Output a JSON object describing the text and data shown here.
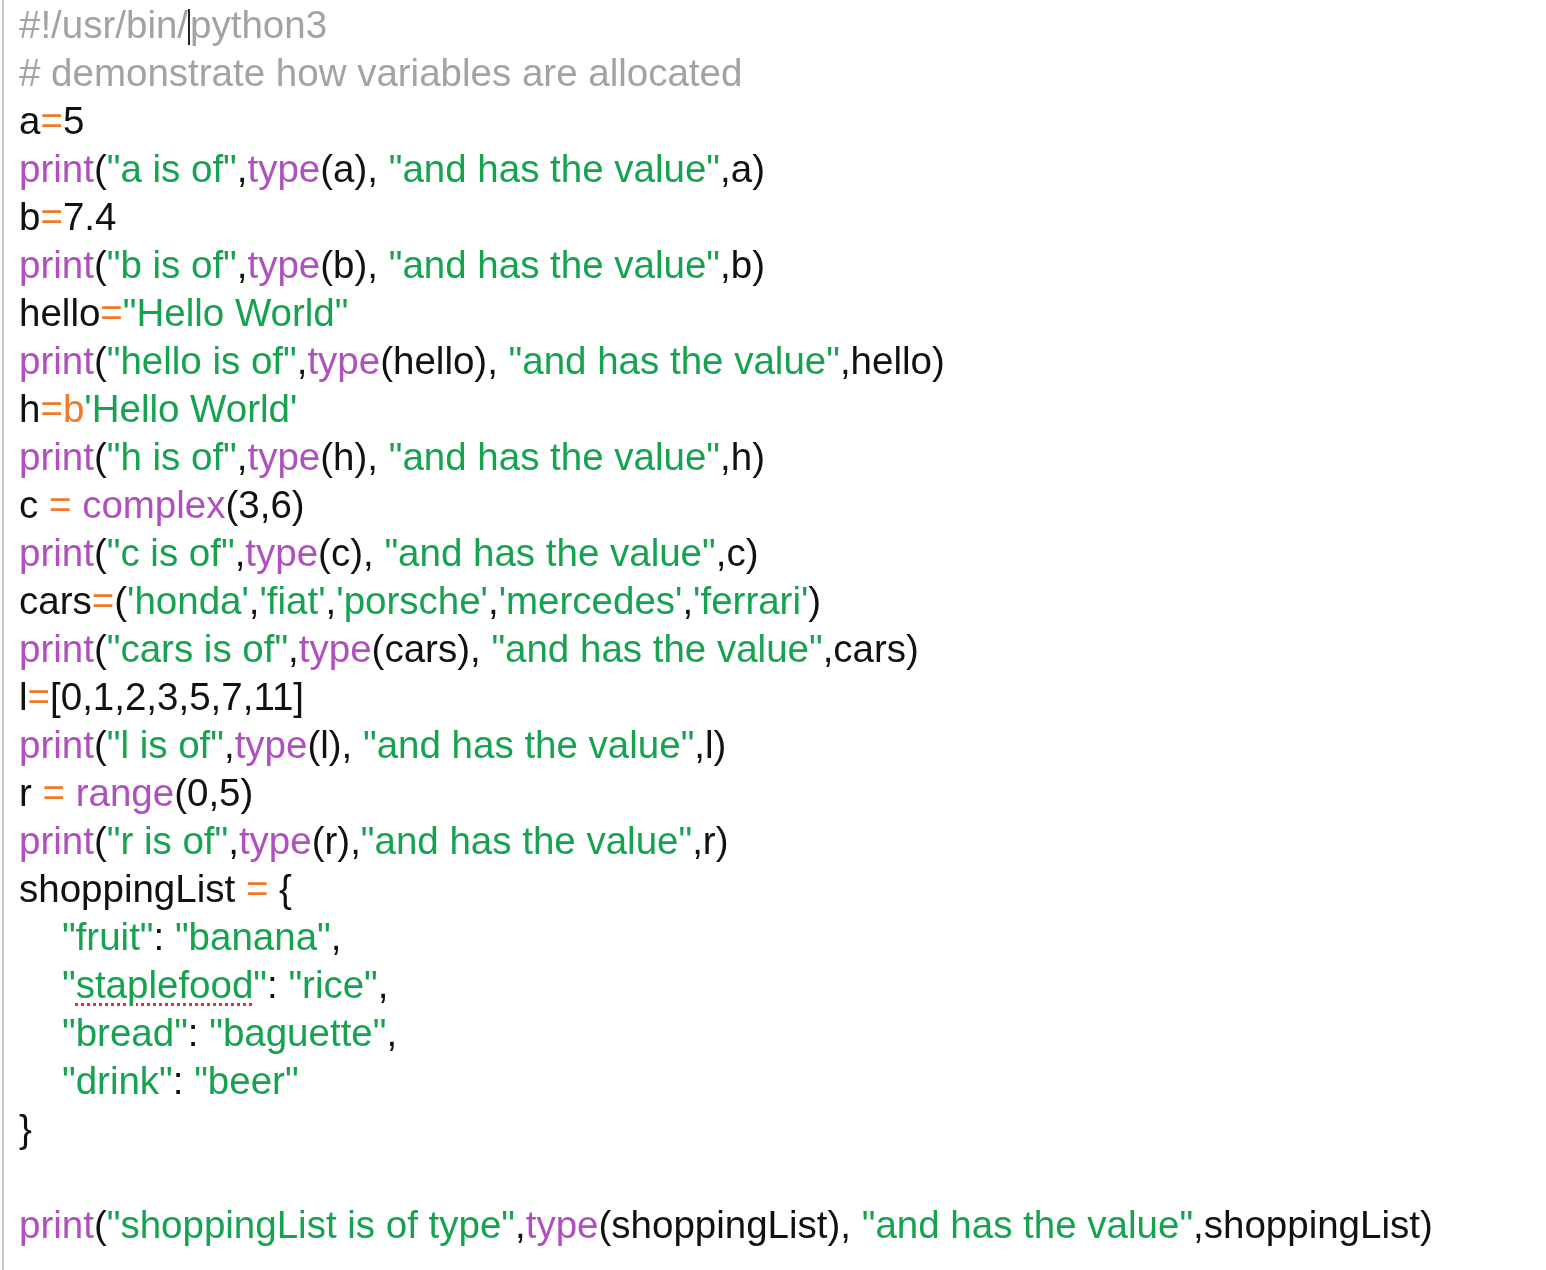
{
  "editor": {
    "lines": [
      {
        "kind": "code",
        "tokens": [
          {
            "kind": "comment",
            "text": "#!/usr/bin/"
          },
          {
            "kind": "comment",
            "text": "python3",
            "caret_before": true
          }
        ]
      },
      {
        "kind": "code",
        "tokens": [
          {
            "kind": "comment",
            "text": "# demonstrate how variables are allocated"
          }
        ]
      },
      {
        "kind": "code",
        "tokens": [
          {
            "kind": "plain",
            "text": "a"
          },
          {
            "kind": "operator",
            "text": "="
          },
          {
            "kind": "plain",
            "text": "5"
          }
        ]
      },
      {
        "kind": "code",
        "tokens": [
          {
            "kind": "builtin",
            "text": "print"
          },
          {
            "kind": "plain",
            "text": "("
          },
          {
            "kind": "string",
            "text": "\"a is of\""
          },
          {
            "kind": "plain",
            "text": ","
          },
          {
            "kind": "builtin",
            "text": "type"
          },
          {
            "kind": "plain",
            "text": "(a), "
          },
          {
            "kind": "string",
            "text": "\"and has the value\""
          },
          {
            "kind": "plain",
            "text": ",a)"
          }
        ]
      },
      {
        "kind": "code",
        "tokens": [
          {
            "kind": "plain",
            "text": "b"
          },
          {
            "kind": "operator",
            "text": "="
          },
          {
            "kind": "plain",
            "text": "7.4"
          }
        ]
      },
      {
        "kind": "code",
        "tokens": [
          {
            "kind": "builtin",
            "text": "print"
          },
          {
            "kind": "plain",
            "text": "("
          },
          {
            "kind": "string",
            "text": "\"b is of\""
          },
          {
            "kind": "plain",
            "text": ","
          },
          {
            "kind": "builtin",
            "text": "type"
          },
          {
            "kind": "plain",
            "text": "(b), "
          },
          {
            "kind": "string",
            "text": "\"and has the value\""
          },
          {
            "kind": "plain",
            "text": ",b)"
          }
        ]
      },
      {
        "kind": "code",
        "tokens": [
          {
            "kind": "plain",
            "text": "hello"
          },
          {
            "kind": "operator",
            "text": "="
          },
          {
            "kind": "string",
            "text": "\"Hello World\""
          }
        ]
      },
      {
        "kind": "code",
        "tokens": [
          {
            "kind": "builtin",
            "text": "print"
          },
          {
            "kind": "plain",
            "text": "("
          },
          {
            "kind": "string",
            "text": "\"hello is of\""
          },
          {
            "kind": "plain",
            "text": ","
          },
          {
            "kind": "builtin",
            "text": "type"
          },
          {
            "kind": "plain",
            "text": "(hello), "
          },
          {
            "kind": "string",
            "text": "\"and has the value\""
          },
          {
            "kind": "plain",
            "text": ",hello)"
          }
        ]
      },
      {
        "kind": "code",
        "tokens": [
          {
            "kind": "plain",
            "text": "h"
          },
          {
            "kind": "operator",
            "text": "=b"
          },
          {
            "kind": "string",
            "text": "'Hello World'"
          }
        ]
      },
      {
        "kind": "code",
        "tokens": [
          {
            "kind": "builtin",
            "text": "print"
          },
          {
            "kind": "plain",
            "text": "("
          },
          {
            "kind": "string",
            "text": "\"h is of\""
          },
          {
            "kind": "plain",
            "text": ","
          },
          {
            "kind": "builtin",
            "text": "type"
          },
          {
            "kind": "plain",
            "text": "(h), "
          },
          {
            "kind": "string",
            "text": "\"and has the value\""
          },
          {
            "kind": "plain",
            "text": ",h)"
          }
        ]
      },
      {
        "kind": "code",
        "tokens": [
          {
            "kind": "plain",
            "text": "c "
          },
          {
            "kind": "operator",
            "text": "= "
          },
          {
            "kind": "builtin",
            "text": "complex"
          },
          {
            "kind": "plain",
            "text": "(3,6)"
          }
        ]
      },
      {
        "kind": "code",
        "tokens": [
          {
            "kind": "builtin",
            "text": "print"
          },
          {
            "kind": "plain",
            "text": "("
          },
          {
            "kind": "string",
            "text": "\"c is of\""
          },
          {
            "kind": "plain",
            "text": ","
          },
          {
            "kind": "builtin",
            "text": "type"
          },
          {
            "kind": "plain",
            "text": "(c), "
          },
          {
            "kind": "string",
            "text": "\"and has the value\""
          },
          {
            "kind": "plain",
            "text": ",c)"
          }
        ]
      },
      {
        "kind": "code",
        "tokens": [
          {
            "kind": "plain",
            "text": "cars"
          },
          {
            "kind": "operator",
            "text": "="
          },
          {
            "kind": "plain",
            "text": "("
          },
          {
            "kind": "string",
            "text": "'honda'"
          },
          {
            "kind": "plain",
            "text": ","
          },
          {
            "kind": "string",
            "text": "'fiat'"
          },
          {
            "kind": "plain",
            "text": ","
          },
          {
            "kind": "string",
            "text": "'porsche'"
          },
          {
            "kind": "plain",
            "text": ","
          },
          {
            "kind": "string",
            "text": "'mercedes'"
          },
          {
            "kind": "plain",
            "text": ","
          },
          {
            "kind": "string",
            "text": "'ferrari'"
          },
          {
            "kind": "plain",
            "text": ")"
          }
        ]
      },
      {
        "kind": "code",
        "tokens": [
          {
            "kind": "builtin",
            "text": "print"
          },
          {
            "kind": "plain",
            "text": "("
          },
          {
            "kind": "string",
            "text": "\"cars is of\""
          },
          {
            "kind": "plain",
            "text": ","
          },
          {
            "kind": "builtin",
            "text": "type"
          },
          {
            "kind": "plain",
            "text": "(cars), "
          },
          {
            "kind": "string",
            "text": "\"and has the value\""
          },
          {
            "kind": "plain",
            "text": ",cars)"
          }
        ]
      },
      {
        "kind": "code",
        "tokens": [
          {
            "kind": "plain",
            "text": "l"
          },
          {
            "kind": "operator",
            "text": "="
          },
          {
            "kind": "plain",
            "text": "[0,1,2,3,5,7,11]"
          }
        ]
      },
      {
        "kind": "code",
        "tokens": [
          {
            "kind": "builtin",
            "text": "print"
          },
          {
            "kind": "plain",
            "text": "("
          },
          {
            "kind": "string",
            "text": "\"l is of\""
          },
          {
            "kind": "plain",
            "text": ","
          },
          {
            "kind": "builtin",
            "text": "type"
          },
          {
            "kind": "plain",
            "text": "(l), "
          },
          {
            "kind": "string",
            "text": "\"and has the value\""
          },
          {
            "kind": "plain",
            "text": ",l)"
          }
        ]
      },
      {
        "kind": "code",
        "tokens": [
          {
            "kind": "plain",
            "text": "r "
          },
          {
            "kind": "operator",
            "text": "= "
          },
          {
            "kind": "builtin",
            "text": "range"
          },
          {
            "kind": "plain",
            "text": "(0,5)"
          }
        ]
      },
      {
        "kind": "code",
        "tokens": [
          {
            "kind": "builtin",
            "text": "print"
          },
          {
            "kind": "plain",
            "text": "("
          },
          {
            "kind": "string",
            "text": "\"r is of\""
          },
          {
            "kind": "plain",
            "text": ","
          },
          {
            "kind": "builtin",
            "text": "type"
          },
          {
            "kind": "plain",
            "text": "(r),"
          },
          {
            "kind": "string",
            "text": "\"and has the value\""
          },
          {
            "kind": "plain",
            "text": ",r)"
          }
        ]
      },
      {
        "kind": "code",
        "tokens": [
          {
            "kind": "plain",
            "text": "shoppingList "
          },
          {
            "kind": "operator",
            "text": "="
          },
          {
            "kind": "plain",
            "text": " {"
          }
        ]
      },
      {
        "kind": "code",
        "indented": true,
        "tokens": [
          {
            "kind": "string",
            "text": "\"fruit\""
          },
          {
            "kind": "plain",
            "text": ": "
          },
          {
            "kind": "string",
            "text": "\"banana\""
          },
          {
            "kind": "plain",
            "text": ","
          }
        ]
      },
      {
        "kind": "code",
        "indented": true,
        "tokens": [
          {
            "kind": "string",
            "text": "\""
          },
          {
            "kind": "string",
            "text": "staplefood",
            "misspelled": true
          },
          {
            "kind": "string",
            "text": "\""
          },
          {
            "kind": "plain",
            "text": ": "
          },
          {
            "kind": "string",
            "text": "\"rice\""
          },
          {
            "kind": "plain",
            "text": ","
          }
        ]
      },
      {
        "kind": "code",
        "indented": true,
        "tokens": [
          {
            "kind": "string",
            "text": "\"bread\""
          },
          {
            "kind": "plain",
            "text": ": "
          },
          {
            "kind": "string",
            "text": "\"baguette\""
          },
          {
            "kind": "plain",
            "text": ","
          }
        ]
      },
      {
        "kind": "code",
        "indented": true,
        "tokens": [
          {
            "kind": "string",
            "text": "\"drink\""
          },
          {
            "kind": "plain",
            "text": ": "
          },
          {
            "kind": "string",
            "text": "\"beer\""
          }
        ]
      },
      {
        "kind": "code",
        "tokens": [
          {
            "kind": "plain",
            "text": "}"
          }
        ]
      },
      {
        "kind": "blank"
      },
      {
        "kind": "code",
        "tokens": [
          {
            "kind": "builtin",
            "text": "print"
          },
          {
            "kind": "plain",
            "text": "("
          },
          {
            "kind": "string",
            "text": "\"shoppingList is of type\""
          },
          {
            "kind": "plain",
            "text": ","
          },
          {
            "kind": "builtin",
            "text": "type"
          },
          {
            "kind": "plain",
            "text": "(shoppingList), "
          },
          {
            "kind": "string",
            "text": "\"and has the value\""
          },
          {
            "kind": "plain",
            "text": ",shoppingList)"
          }
        ]
      }
    ]
  }
}
